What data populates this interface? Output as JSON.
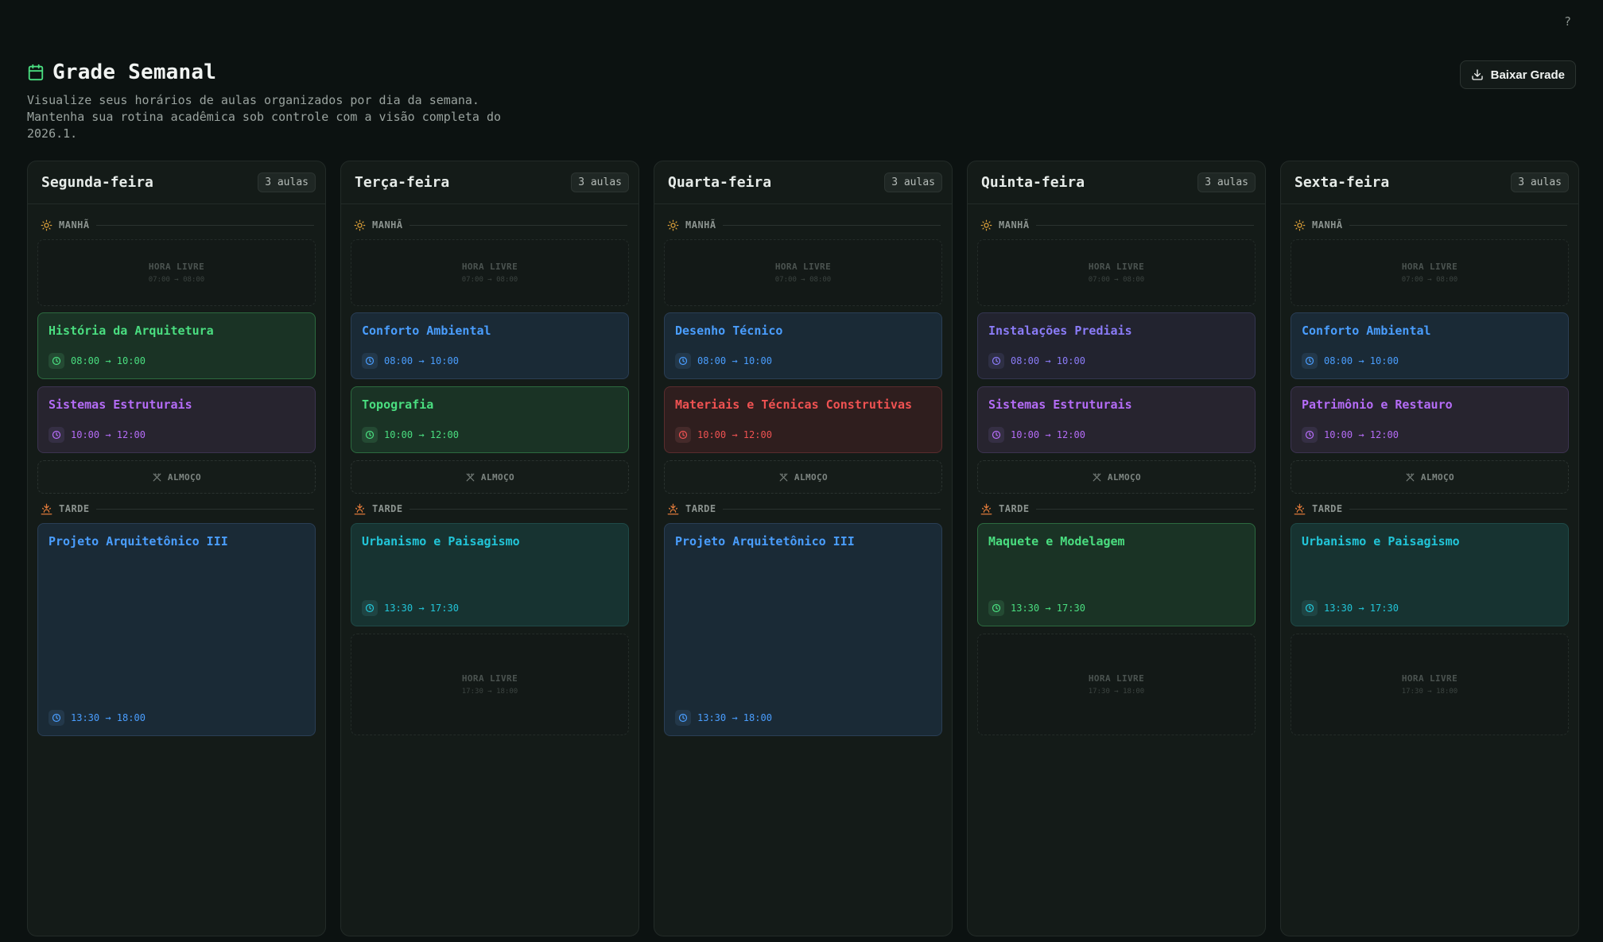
{
  "help_label": "?",
  "header": {
    "title": "Grade Semanal",
    "subtitle": "Visualize seus horários de aulas organizados por dia da semana. Mantenha sua rotina acadêmica sob controle com a visão completa do 2026.1.",
    "download_label": "Baixar Grade"
  },
  "labels": {
    "morning": "MANHÃ",
    "afternoon": "TARDE",
    "lunch": "ALMOÇO",
    "free": "HORA LIVRE"
  },
  "colors": {
    "green": "#4ade80",
    "blue": "#4a9eff",
    "purple": "#b56cf7",
    "red": "#f05252",
    "indigo": "#8b7cf8",
    "teal": "#22c5d8"
  },
  "days": [
    {
      "name": "Segunda-feira",
      "count": "3 aulas",
      "morning_free": "07:00 → 08:00",
      "morning_classes": [
        {
          "name": "História da Arquitetura",
          "time": "08:00 → 10:00",
          "color": "green"
        },
        {
          "name": "Sistemas Estruturais",
          "time": "10:00 → 12:00",
          "color": "purple"
        }
      ],
      "afternoon_class": {
        "name": "Projeto Arquitetônico III",
        "time": "13:30 → 18:00",
        "color": "blue",
        "long": true
      },
      "afternoon_free": ""
    },
    {
      "name": "Terça-feira",
      "count": "3 aulas",
      "morning_free": "07:00 → 08:00",
      "morning_classes": [
        {
          "name": "Conforto Ambiental",
          "time": "08:00 → 10:00",
          "color": "blue"
        },
        {
          "name": "Topografia",
          "time": "10:00 → 12:00",
          "color": "green"
        }
      ],
      "afternoon_class": {
        "name": "Urbanismo e Paisagismo",
        "time": "13:30 → 17:30",
        "color": "teal",
        "long": false
      },
      "afternoon_free": "17:30 → 18:00"
    },
    {
      "name": "Quarta-feira",
      "count": "3 aulas",
      "morning_free": "07:00 → 08:00",
      "morning_classes": [
        {
          "name": "Desenho Técnico",
          "time": "08:00 → 10:00",
          "color": "blue"
        },
        {
          "name": "Materiais e Técnicas Construtivas",
          "time": "10:00 → 12:00",
          "color": "red"
        }
      ],
      "afternoon_class": {
        "name": "Projeto Arquitetônico III",
        "time": "13:30 → 18:00",
        "color": "blue",
        "long": true
      },
      "afternoon_free": ""
    },
    {
      "name": "Quinta-feira",
      "count": "3 aulas",
      "morning_free": "07:00 → 08:00",
      "morning_classes": [
        {
          "name": "Instalações Prediais",
          "time": "08:00 → 10:00",
          "color": "indigo"
        },
        {
          "name": "Sistemas Estruturais",
          "time": "10:00 → 12:00",
          "color": "purple"
        }
      ],
      "afternoon_class": {
        "name": "Maquete e Modelagem",
        "time": "13:30 → 17:30",
        "color": "green",
        "long": false
      },
      "afternoon_free": "17:30 → 18:00"
    },
    {
      "name": "Sexta-feira",
      "count": "3 aulas",
      "morning_free": "07:00 → 08:00",
      "morning_classes": [
        {
          "name": "Conforto Ambiental",
          "time": "08:00 → 10:00",
          "color": "blue"
        },
        {
          "name": "Patrimônio e Restauro",
          "time": "10:00 → 12:00",
          "color": "purple"
        }
      ],
      "afternoon_class": {
        "name": "Urbanismo e Paisagismo",
        "time": "13:30 → 17:30",
        "color": "teal",
        "long": false
      },
      "afternoon_free": "17:30 → 18:00"
    }
  ]
}
